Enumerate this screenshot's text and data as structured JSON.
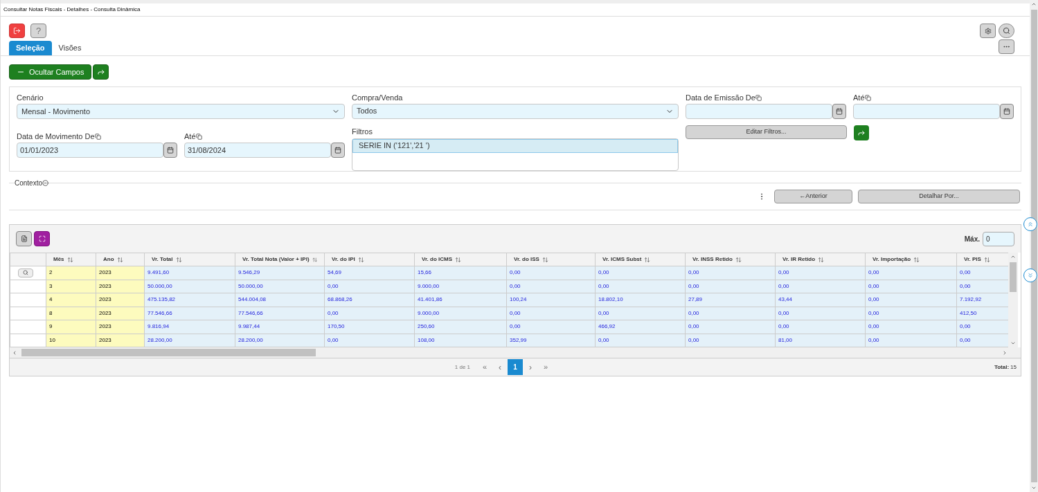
{
  "window": {
    "title": "Consultar Notas Fiscais - Detalhes - Consulta Dinâmica"
  },
  "tabs": [
    {
      "label": "Seleção",
      "selected": true
    },
    {
      "label": "Visões",
      "selected": false
    }
  ],
  "help_button": "?",
  "toggle_button": "Ocultar Campos",
  "form": {
    "cenario": {
      "label": "Cenário",
      "value": "Mensal - Movimento"
    },
    "compra_venda": {
      "label": "Compra/Venda",
      "value": "Todos"
    },
    "emissao_de": {
      "label": "Data de Emissão De"
    },
    "emissao_ate": {
      "label": "Até"
    },
    "edit_filters": "Editar Filtros...",
    "filtros": {
      "label": "Filtros",
      "items": [
        {
          "text": "SERIE IN ('121','21 ')",
          "selected": true
        }
      ]
    },
    "movimento_de": {
      "label": "Data de Movimento De",
      "value": "01/01/2023"
    },
    "movimento_ate": {
      "label": "Até",
      "value": "31/08/2024"
    }
  },
  "context": {
    "label": "Contexto",
    "back": "←Anterior",
    "detail": "Detalhar Por..."
  },
  "grid": {
    "max_label": "Máx.",
    "max_value": "0",
    "columns": [
      "Mês",
      "Ano",
      "Vr. Total",
      "Vr. Total Nota (Valor + IPI)",
      "Vr. do IPI",
      "Vr. do ICMS",
      "Vr. do ISS",
      "Vr. ICMS Subst",
      "Vr. INSS Retido",
      "Vr. IR Retido",
      "Vr. Importação",
      "Vr. PIS"
    ],
    "rows": [
      {
        "search": true,
        "cells": [
          "2",
          "2023",
          "9.491,60",
          "9.546,29",
          "54,69",
          "15,66",
          "0,00",
          "0,00",
          "0,00",
          "0,00",
          "0,00",
          "0,00"
        ]
      },
      {
        "search": false,
        "cells": [
          "3",
          "2023",
          "50.000,00",
          "50.000,00",
          "0,00",
          "9.000,00",
          "0,00",
          "0,00",
          "0,00",
          "0,00",
          "0,00",
          "0,00"
        ]
      },
      {
        "search": false,
        "cells": [
          "4",
          "2023",
          "475.135,82",
          "544.004,08",
          "68.868,26",
          "41.401,86",
          "100,24",
          "18.802,10",
          "27,89",
          "43,44",
          "0,00",
          "7.192,92"
        ]
      },
      {
        "search": false,
        "cells": [
          "8",
          "2023",
          "77.546,66",
          "77.546,66",
          "0,00",
          "9.000,00",
          "0,00",
          "0,00",
          "0,00",
          "0,00",
          "0,00",
          "412,50"
        ]
      },
      {
        "search": false,
        "cells": [
          "9",
          "2023",
          "9.816,94",
          "9.987,44",
          "170,50",
          "250,60",
          "0,00",
          "466,92",
          "0,00",
          "0,00",
          "0,00",
          "0,00"
        ]
      },
      {
        "search": false,
        "cells": [
          "10",
          "2023",
          "28.200,00",
          "28.200,00",
          "0,00",
          "108,00",
          "352,99",
          "0,00",
          "0,00",
          "81,00",
          "0,00",
          "0,00"
        ]
      }
    ],
    "pager": {
      "info": "1 de 1",
      "first": "«",
      "prev": "‹",
      "pages": [
        {
          "label": "1",
          "selected": true
        }
      ],
      "next": "›",
      "last": "»",
      "total_label": "Total:",
      "total_value": "15"
    }
  }
}
